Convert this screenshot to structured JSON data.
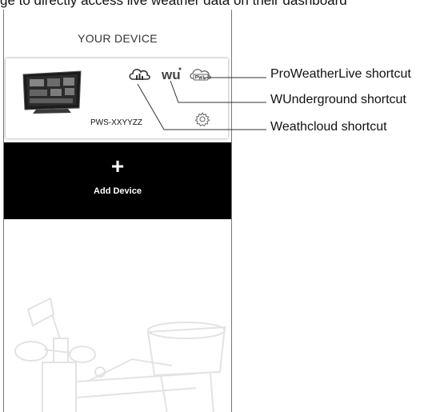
{
  "top_text": "ge to directly access live weather data on their dashboard",
  "section_title": "YOUR DEVICE",
  "device": {
    "name": "PWS-XXYYZZ",
    "image_icon": "weather-display-console",
    "settings_icon": "gear-icon"
  },
  "shortcuts": {
    "weathercloud_icon": "cloud-chart-icon",
    "wunderground_icon": "wu-logo-icon",
    "proweatherlive_icon": "pwl-logo-icon",
    "wu_text": "wu"
  },
  "add_device": {
    "plus": "+",
    "label": "Add Device"
  },
  "callouts": {
    "proweatherlive": "ProWeatherLive shortcut",
    "wunderground": "WUnderground shortcut",
    "weathercloud": "Weathcloud shortcut"
  },
  "colors": {
    "add_device_bg": "#000000",
    "callout_line": "#333333",
    "background_art": "#e6e6e6"
  }
}
